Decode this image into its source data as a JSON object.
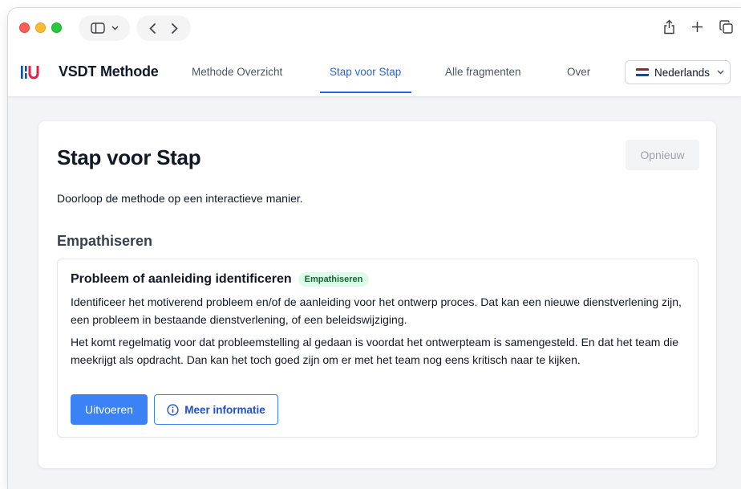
{
  "browser": {
    "icons": [
      "sidebar-icon",
      "chevron-down-icon",
      "back-icon",
      "forward-icon",
      "share-icon",
      "new-tab-icon",
      "tabs-overview-icon"
    ]
  },
  "header": {
    "brand": "VSDT Methode",
    "nav": [
      {
        "label": "Methode Overzicht",
        "active": false
      },
      {
        "label": "Stap voor Stap",
        "active": true
      },
      {
        "label": "Alle fragmenten",
        "active": false
      },
      {
        "label": "Over",
        "active": false
      }
    ],
    "language": {
      "label": "Nederlands",
      "flag": [
        "#ae1c28",
        "#ffffff",
        "#21468b"
      ]
    },
    "logo_colors": {
      "bars": "#0e4fae",
      "letter": "#e11d48"
    }
  },
  "main": {
    "title": "Stap voor Stap",
    "reset_label": "Opnieuw",
    "intro": "Doorloop de methode op een interactieve manier.",
    "section": "Empathiseren",
    "step": {
      "title": "Probleem of aanleiding identificeren",
      "badge": "Empathiseren",
      "description": "Identificeer het motiverend probleem en/of de aanleiding voor het ontwerp proces. Dat kan een nieuwe dienstverlening zijn, een probleem in bestaande dienstverlening, of een beleidswijziging.",
      "note": "Het komt regelmatig voor dat probleemstelling al gedaan is voordat het ontwerpteam is samengesteld. En dat het team die meekrijgt als opdracht. Dan kan het toch goed zijn om er met het team nog eens kritisch naar te kijken.",
      "execute_label": "Uitvoeren",
      "info_label": "Meer informatie"
    }
  },
  "colors": {
    "accent": "#2563eb",
    "primary_button": "#3b82f6",
    "badge_bg": "#dcfce7",
    "badge_text": "#166534"
  }
}
